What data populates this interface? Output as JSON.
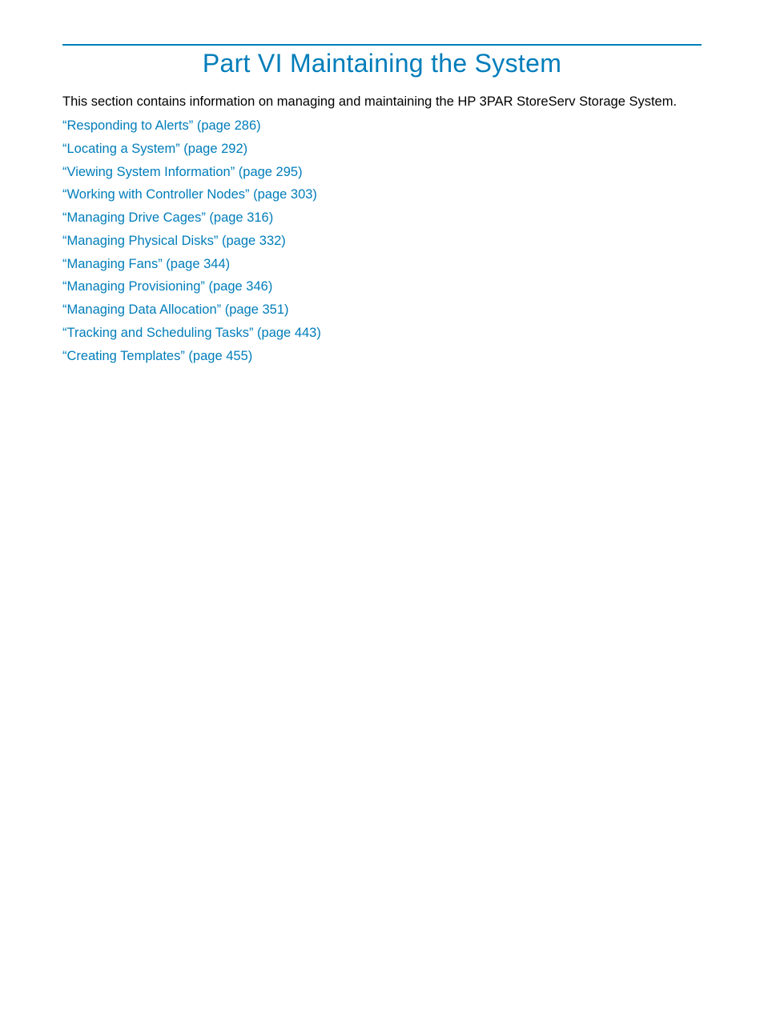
{
  "title": "Part VI Maintaining the System",
  "intro": "This section contains information on managing and maintaining the HP 3PAR StoreServ Storage System.",
  "links": [
    "“Responding to Alerts” (page 286)",
    "“Locating a System” (page 292)",
    "“Viewing System Information” (page 295)",
    "“Working with Controller Nodes” (page 303)",
    "“Managing Drive Cages” (page 316)",
    "“Managing Physical Disks” (page 332)",
    "“Managing Fans” (page 344)",
    "“Managing Provisioning” (page 346)",
    "“Managing Data Allocation” (page 351)",
    "“Tracking and Scheduling Tasks” (page 443)",
    "“Creating Templates” (page 455)"
  ]
}
